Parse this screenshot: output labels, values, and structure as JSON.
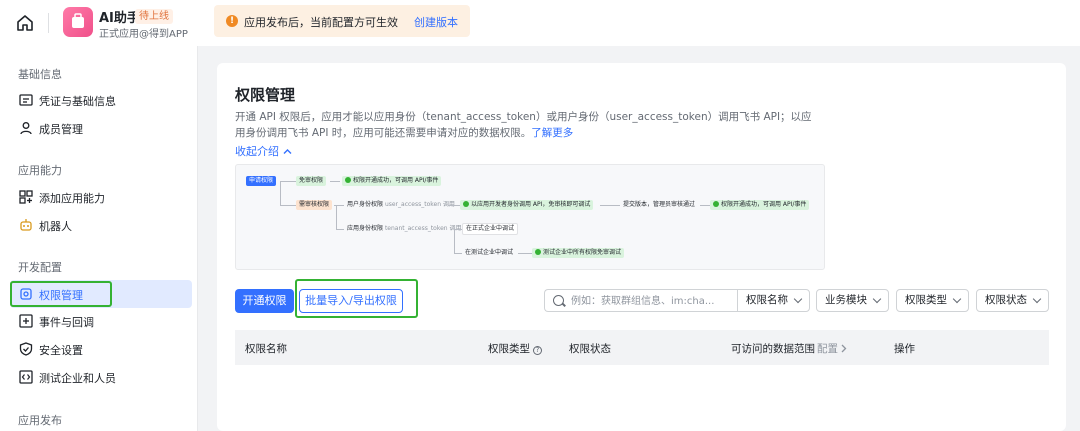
{
  "topbar": {
    "app_name": "AI助手",
    "app_status": "待上线",
    "app_org": "正式应用@得到APP",
    "notice_text": "应用发布后，当前配置方可生效",
    "notice_link": "创建版本"
  },
  "sidebar": {
    "groups": [
      "基础信息",
      "应用能力",
      "开发配置",
      "应用发布"
    ],
    "items": [
      {
        "label": "凭证与基础信息",
        "icon": "id-card-icon"
      },
      {
        "label": "成员管理",
        "icon": "user-icon"
      },
      {
        "label": "添加应用能力",
        "icon": "apps-icon"
      },
      {
        "label": "机器人",
        "icon": "robot-icon"
      },
      {
        "label": "权限管理",
        "icon": "key-icon",
        "active": true
      },
      {
        "label": "事件与回调",
        "icon": "event-icon"
      },
      {
        "label": "安全设置",
        "icon": "shield-icon"
      },
      {
        "label": "测试企业和人员",
        "icon": "code-icon"
      }
    ]
  },
  "main": {
    "title": "权限管理",
    "desc": "开通 API 权限后，应用才能以应用身份（tenant_access_token）或用户身份（user_access_token）调用飞书 API；以应用身份调用飞书 API 时，应用可能还需要申请对应的数据权限。",
    "learn_more": "了解更多",
    "collapse": "收起介绍",
    "flow": {
      "apply": "申请权限",
      "no_review": "免审权限",
      "ok_call": "权限开通成功，可调用 API/事件",
      "need_review": "需审核权限",
      "user_identity": "用户身份权限",
      "user_token": "user_access_token 调用",
      "dev_identity": "以应用开发者身份调用 API，免审核即可调试",
      "submit": "提交版本，管理员审核通过",
      "ok_call2": "权限开通成功，可调用 API/事件",
      "app_identity": "应用身份权限",
      "tenant_token": "tenant_access_token 调用",
      "prod_debug": "在正式企业中调试",
      "test_debug": "在测试企业中调试",
      "test_ok": "测试企业中所有权限免审调试"
    },
    "btn_enable": "开通权限",
    "btn_batch": "批量导入/导出权限",
    "search_placeholder": "例如：获取群组信息、im:cha...",
    "filters": [
      "权限名称",
      "业务模块",
      "权限类型",
      "权限状态"
    ],
    "columns": {
      "name": "权限名称",
      "type": "权限类型",
      "status": "权限状态",
      "scope": "可访问的数据范围",
      "scope_config": "配置",
      "ops": "操作"
    }
  }
}
